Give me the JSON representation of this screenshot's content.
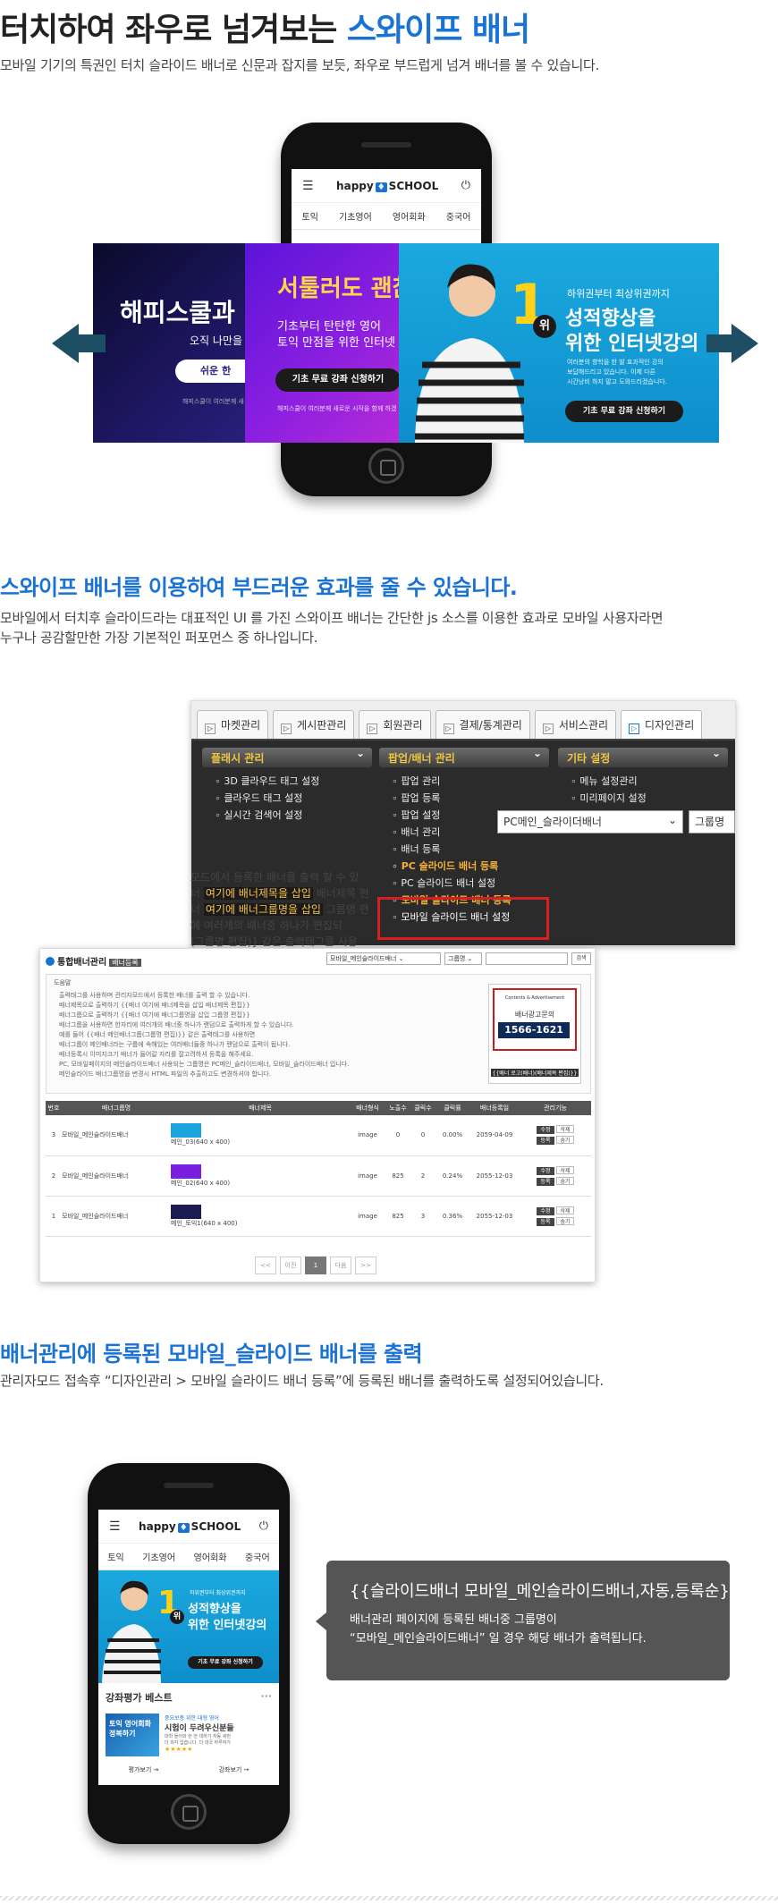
{
  "section1": {
    "title_plain": "터치하여 좌우로 넘겨보는 ",
    "title_accent": "스와이프 배너",
    "desc": "모바일 기기의 특권인 터치 슬라이드 배너로 신문과 잡지를 보듯, 좌우로 부드럽게 넘겨 배너를 볼 수 있습니다."
  },
  "mobile": {
    "logo_left": "happy",
    "logo_box": "♦",
    "logo_right": "SCHOOL",
    "nav": [
      "토익",
      "기초영어",
      "영어회화",
      "중국어"
    ]
  },
  "banners": {
    "dark_title": "해피스쿨과",
    "dark_sub": "오직 나만을",
    "dark_btn": "쉬운 한",
    "dark_foot": "해피스쿨이 여러분께 새",
    "purple_title": "서툴러도 괜찮",
    "purple_line1": "기초부터 탄탄한 영어",
    "purple_line2": "토익 만점을 위한 인터넷",
    "purple_btn": "기초 무료 강좌 신청하기",
    "purple_foot": "해피스쿨이 여러분께 새로운 시작을 함께 하겠",
    "blue_rank": "1",
    "blue_rank_word": "위",
    "blue_top": "하위권부터 최상위권까지",
    "blue_line1": "성적향상을",
    "blue_line2": "위한 인터넷강의",
    "blue_small1": "여러분의 향학을 한 발 효과적인 강의",
    "blue_small2": "보답해드리고 있습니다. 이제 다른",
    "blue_small3": "시간낭비 하지 말고 도와드리겠습니다.",
    "blue_btn": "기초 무료 강좌 신청하기"
  },
  "section2": {
    "title": "스와이프 배너를 이용하여 부드러운 효과를 줄 수 있습니다.",
    "desc1": "모바일에서 터치후 슬라이드라는 대표적인 UI 를 가진 스와이프 배너는 간단한 js 소스를 이용한 효과로 모바일 사용자라면",
    "desc2": "누구나 공감할만한 가장 기본적인 퍼포먼스 중 하나입니다."
  },
  "admin_menu": {
    "tabs": [
      "마켓관리",
      "게시판관리",
      "회원관리",
      "결제/통계관리",
      "서비스관리",
      "디자인관리"
    ],
    "col1_head": "플래시 관리",
    "col1_items": [
      "3D 클라우드 태그 설정",
      "클라우드 태그 설정",
      "실시간 검색어 설정"
    ],
    "col2_head": "팝업/배너 관리",
    "col2_items": [
      "팝업 관리",
      "팝업 등록",
      "팝업 설정",
      "배너 관리",
      "배너 등록",
      "PC 슬라이드 배너 등록",
      "PC 슬라이드 배너 설정",
      "모바일 슬라이드 배너 등록",
      "모바일 슬라이드 배너 설정"
    ],
    "col3_head": "기타 설정",
    "col3_items": [
      "메뉴 설정관리",
      "미리페이지 설정"
    ],
    "select_value": "PC메인_슬라이더배너",
    "group_btn": "그룹명",
    "ghost1": "모드에서 등록한 배너를 출력 할 수 있",
    "ghost2a": "너 ",
    "ghost2b": "여기에 배너제목을 삽입",
    "ghost2c": " 배너제목 편",
    "ghost3a": "너 ",
    "ghost3b": "여기에 배너그룹명을 삽입",
    "ghost3c": " 그룹명 편",
    "ghost4": "에 여러개의 배너중 하나가 편집되",
    "ghost5": "(그룹명 편집)} 같은 출력태그를 사용"
  },
  "admin_main": {
    "title": "통합배너관리",
    "tag": "배너등록",
    "select_value": "모바일_메인슬라이드배너",
    "group_select": "그룹명",
    "search_btn": "검색",
    "help_label": "도움말",
    "help_lines": [
      "출력태그를 사용하며 관리자모드에서 등록한 배너를 출력 할 수 있습니다.",
      "배너제목으로 출력하기 {{배너 여기에 배너제목을 삽입 배너제목 편집}}",
      "배너그룹으로 출력하기 {{배너 여기에 배너그룹명을 삽입 그룹명 편집}}",
      "배너그룹을 사용하면 한자리에 여러개의 배너중 하나가 랜덤으로 출력하게 할 수 있습니다.",
      "예를 들어 {{배너 메인배너그룹(그룹명 편집)}} 같은 출력태그를 사용하면",
      "배너그룹이 메인배너라는 구룹에 속해있는 여러배너들중 하나가 랜덤으로 출력이 됩니다.",
      "배너등록시 이미지크기 배너가 들어갈 자리를 잘고려하셔 등록을 해주세요.",
      "PC, 모바일페이지의 메인슬라이드배너 사용되는 그룹명은 PC메인_슬라이드배너, 모바일_슬라이드배너 입니다.",
      "메인슬라이드 배너그룹명을 변경시 HTML 파일의 추출하고도 변경하셔야 합니다."
    ],
    "preview_top": "Contents & Advertisement",
    "preview_sub": "배너광고문의",
    "preview_tel": "1566-1621",
    "preview_caption": "{{배너 로고(배너)(배너제목 편집)}}",
    "columns": [
      "번호",
      "배너그룹명",
      "배너제목",
      "배너형식",
      "노출수",
      "클릭수",
      "클릭률",
      "배너등록일",
      "관리기능"
    ],
    "rows": [
      {
        "no": "3",
        "group": "모바일_메인슬라이드배너",
        "name": "메인_03(640 x 400)",
        "type": "image",
        "views": "0",
        "clicks": "0",
        "rate": "0.00%",
        "date": "2059-04-09"
      },
      {
        "no": "2",
        "group": "모바일_메인슬라이드배너",
        "name": "메인_02(640 x 400)",
        "type": "image",
        "views": "825",
        "clicks": "2",
        "rate": "0.24%",
        "date": "2055-12-03"
      },
      {
        "no": "1",
        "group": "모바일_메인슬라이드배너",
        "name": "메인_토익1(640 x 400)",
        "type": "image",
        "views": "825",
        "clicks": "3",
        "rate": "0.36%",
        "date": "2055-12-03"
      }
    ],
    "btn_edit": "수정",
    "btn_delete": "삭제",
    "btn_up": "등록",
    "btn_down": "숨기",
    "pager": [
      "<<",
      "이전",
      "1",
      "다음",
      ">>"
    ]
  },
  "section3": {
    "title": "배너관리에 등록된 모바일_슬라이드 배너를 출력",
    "desc": "관리자모드 접속후 “디자인관리 > 모바일 슬라이드 배너 등록”에 등록된 배너를 출력하도록 설정되어있습니다."
  },
  "phone2": {
    "banner_top": "하위권부터 최상위권까지",
    "banner_line1": "성적향상을",
    "banner_line2": "위한 인터넷강의",
    "banner_btn": "기초 무료 강좌 신청하기",
    "rank": "1",
    "rank_word": "위",
    "best_title": "강좌평가 베스트",
    "more": "···",
    "thumb_text": "토익 영어회화 정복하기",
    "review_tag": "중요보충 위한 대형 영어",
    "review_title": "시험이 두려우신분들",
    "review_line1": "대학 들어와 쓴 안 대하기 자동 세번",
    "review_line2": "더 외각 입습니다. 더 대국 하루여가",
    "stars": "★★★★★",
    "link1": "평가보기 →",
    "link2": "강좌보기 →"
  },
  "bubble": {
    "code": "{{슬라이드배너 모바일_메인슬라이드배너,자동,등록순}}",
    "desc1": "배너관리 페이지에 등록된 배너중 그룹명이",
    "desc2": "“모바일_메인슬라이드배너” 일 경우 해당 배너가 출력됩니다."
  }
}
